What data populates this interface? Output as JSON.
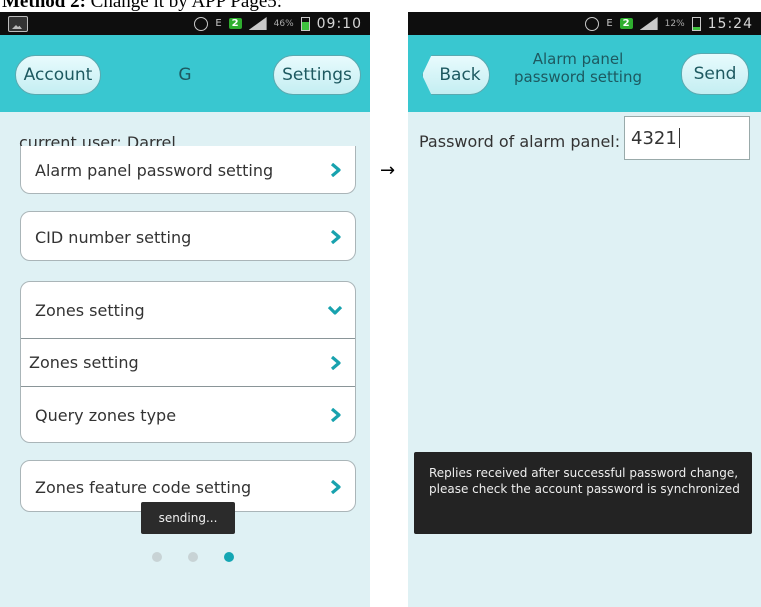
{
  "doc": {
    "heading_bold": "Method 2:",
    "heading_rest": " Change it by APP Page5:"
  },
  "arrow": "→",
  "left_screen": {
    "status_bar": {
      "time": "09:10",
      "battery_pct": "46%",
      "sim_badge": "2"
    },
    "app_bar": {
      "account_label": "Account",
      "title": "G",
      "settings_label": "Settings"
    },
    "current_user_label": "current user:",
    "current_user_name": "Darrel",
    "menu": {
      "alarm_password": "Alarm panel password setting",
      "cid_number": "CID number setting",
      "zones_group": "Zones setting",
      "zones_setting": "Zones setting",
      "query_zones_type": "Query zones type",
      "zones_feature_code": "Zones feature code setting"
    },
    "toast": "sending...",
    "pager": {
      "count": 3,
      "active_index": 2
    }
  },
  "right_screen": {
    "status_bar": {
      "time": "15:24",
      "battery_pct": "12%",
      "sim_badge": "2"
    },
    "app_bar": {
      "back_label": "Back",
      "title_line1": "Alarm panel",
      "title_line2": "password setting",
      "send_label": "Send"
    },
    "password_label": "Password of alarm panel:",
    "password_value": "4321",
    "toast": "Replies received after successful password change, please check the account password is synchronized"
  },
  "colors": {
    "app_bar": "#39c7d0",
    "screen_bg": "#dff1f4",
    "chevron": "#18a2ae",
    "pager_active": "#14a6b3"
  },
  "icons": [
    "image-icon",
    "alarm-clock-icon",
    "sim-icon",
    "signal-icon",
    "battery-icon",
    "chevron-right-icon",
    "chevron-down-icon",
    "back-arrow-icon"
  ]
}
